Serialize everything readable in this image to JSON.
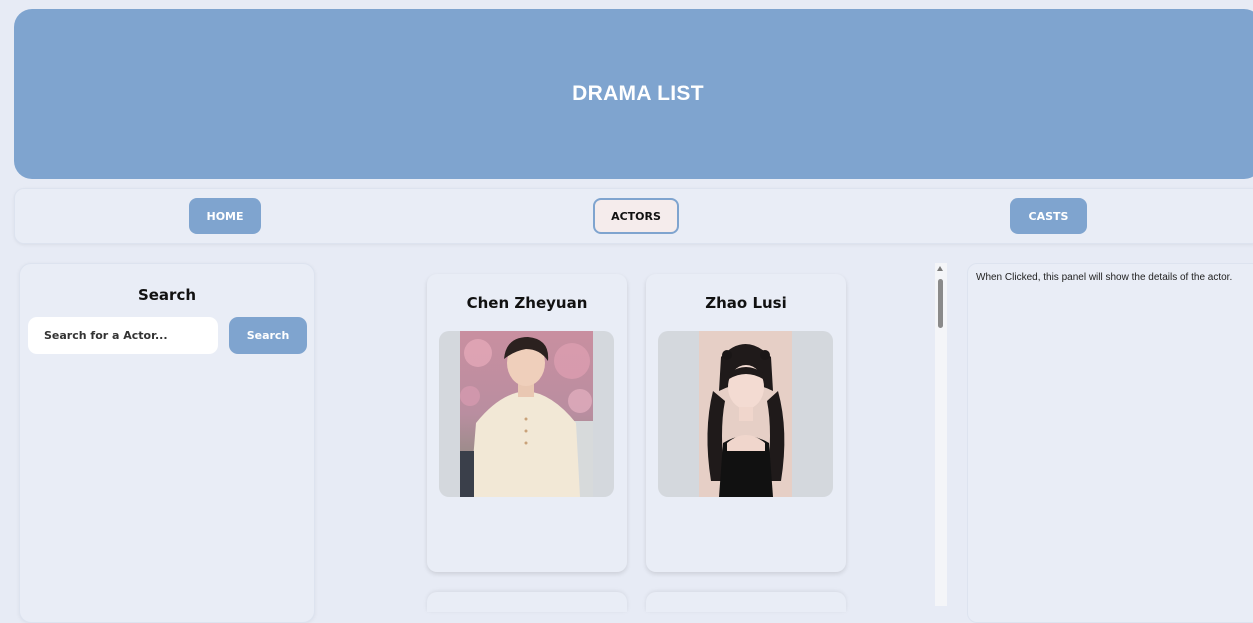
{
  "header": {
    "title": "DRAMA LIST"
  },
  "nav": {
    "home_label": "HOME",
    "actors_label": "ACTORS",
    "casts_label": "CASTS",
    "active": "ACTORS"
  },
  "search": {
    "title": "Search",
    "placeholder": "Search for a Actor...",
    "button_label": "Search"
  },
  "actors": [
    {
      "name": "Chen Zheyuan",
      "photo": "actor-photo"
    },
    {
      "name": "Zhao Lusi",
      "photo": "actor-photo"
    }
  ],
  "detail": {
    "text": "When Clicked, this panel will show the details of the actor."
  },
  "colors": {
    "accent": "#7fa4cf",
    "background": "#e7ebf5",
    "active_button": "#f5ecec"
  }
}
